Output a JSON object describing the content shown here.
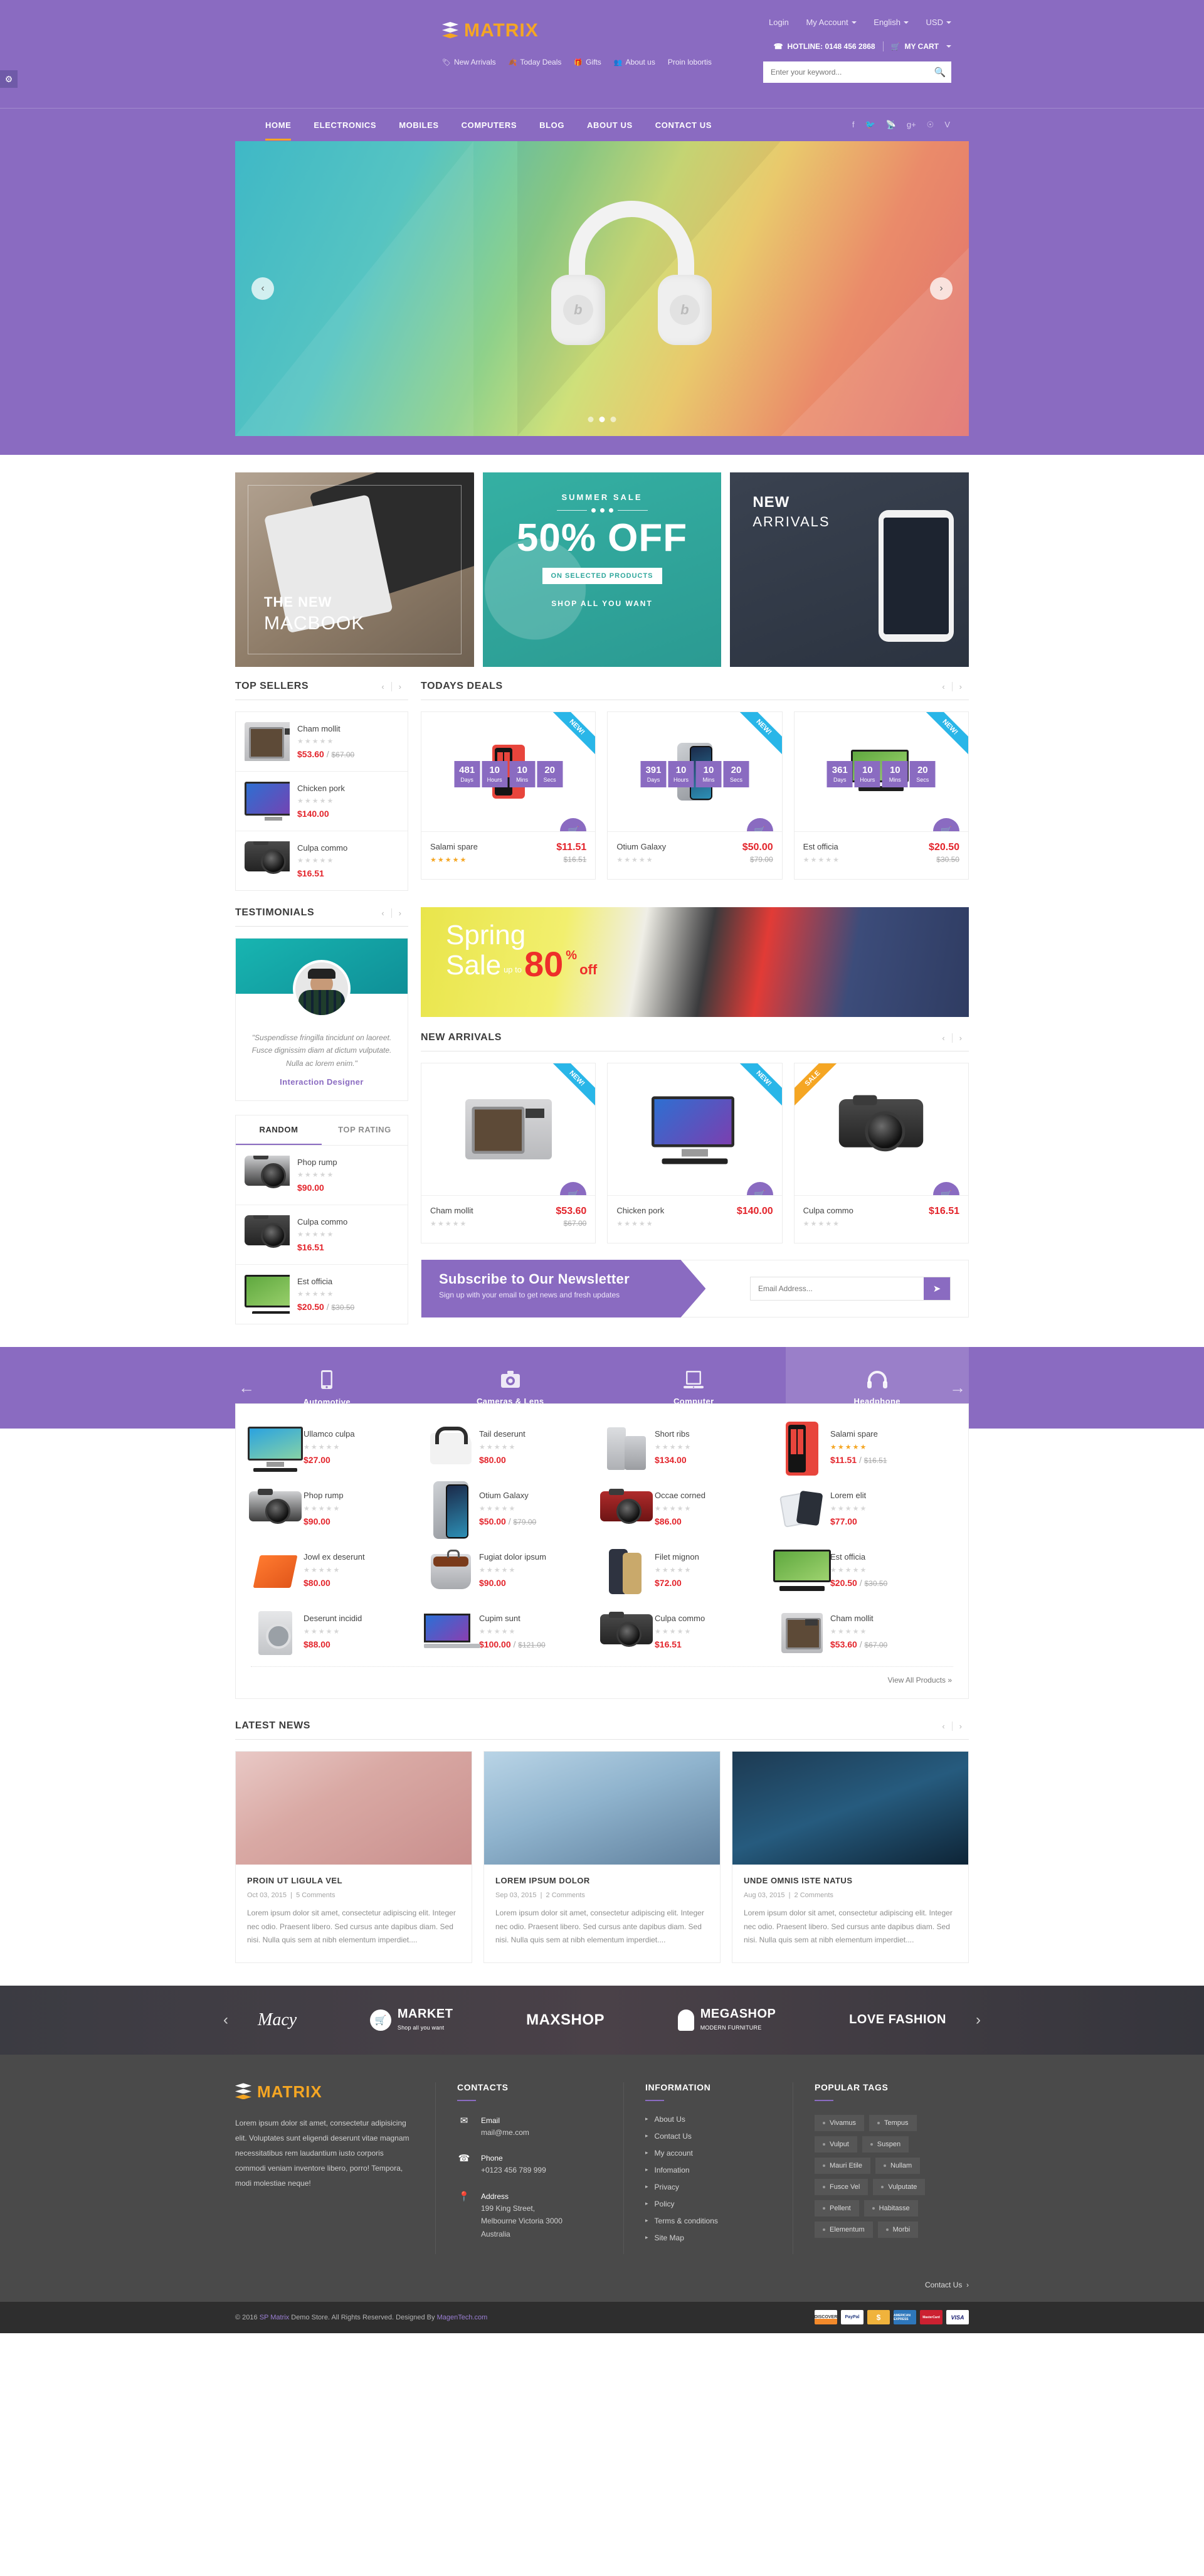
{
  "brand": {
    "name_main": "MATRI",
    "name_accent": "X"
  },
  "topbar": {
    "links": [
      {
        "label": "Login",
        "caret": false
      },
      {
        "label": "My Account",
        "caret": true
      },
      {
        "label": "English",
        "caret": true
      },
      {
        "label": "USD",
        "caret": true
      }
    ],
    "hotline": "HOTLINE: 0148 456 2868",
    "cart": "MY CART"
  },
  "search": {
    "placeholder": "Enter your keyword...",
    "value": ""
  },
  "quick_links": [
    {
      "label": "New Arrivals",
      "icon": "tag-icon"
    },
    {
      "label": "Today Deals",
      "icon": "leaf-icon"
    },
    {
      "label": "Gifts",
      "icon": "gift-icon"
    },
    {
      "label": "About us",
      "icon": "users-icon"
    },
    {
      "label": "Proin lobortis",
      "icon": ""
    }
  ],
  "nav": {
    "items": [
      "HOME",
      "ELECTRONICS",
      "MOBILES",
      "COMPUTERS",
      "BLOG",
      "ABOUT US",
      "CONTACT US"
    ],
    "active": "HOME",
    "socials": [
      "facebook-icon",
      "twitter-icon",
      "rss-icon",
      "google-plus-icon",
      "pinterest-icon",
      "vine-icon"
    ]
  },
  "slider": {
    "dots": 3,
    "active_dot": 2,
    "prev": "‹",
    "next": "›"
  },
  "promos": [
    {
      "id": "macbook",
      "line1": "THE NEW",
      "line2": "MACBOOK"
    },
    {
      "id": "summer-sale",
      "eyebrow": "SUMMER SALE",
      "headline": "50% OFF",
      "pill": "ON SELECTED PRODUCTS",
      "footer": "SHOP ALL YOU WANT"
    },
    {
      "id": "new-arrivals",
      "line1": "NEW",
      "line2": "ARRIVALS"
    }
  ],
  "top_sellers": {
    "title": "TOP SELLERS",
    "items": [
      {
        "name": "Cham mollit",
        "stars": 0,
        "price": "$53.60",
        "old": "$67.00",
        "art": "microwave"
      },
      {
        "name": "Chicken pork",
        "stars": 0,
        "price": "$140.00",
        "old": "",
        "art": "monitor"
      },
      {
        "name": "Culpa commo",
        "stars": 0,
        "price": "$16.51",
        "old": "",
        "art": "camera"
      }
    ]
  },
  "todays_deals": {
    "title": "TODAYS DEALS",
    "items": [
      {
        "name": "Salami spare",
        "price": "$11.51",
        "old": "$16.51",
        "stars": 5,
        "badge": "NEW!",
        "badge_type": "new",
        "countdown": {
          "days": "481",
          "hours": "10",
          "mins": "10",
          "secs": "20"
        },
        "art": "phone-red"
      },
      {
        "name": "Otium Galaxy",
        "price": "$50.00",
        "old": "$79.00",
        "stars": 0,
        "badge": "NEW!",
        "badge_type": "new",
        "countdown": {
          "days": "391",
          "hours": "10",
          "mins": "10",
          "secs": "20"
        },
        "art": "phone-silver"
      },
      {
        "name": "Est officia",
        "price": "$20.50",
        "old": "$30.50",
        "stars": 0,
        "badge": "NEW!",
        "badge_type": "new",
        "countdown": {
          "days": "361",
          "hours": "10",
          "mins": "10",
          "secs": "20"
        },
        "art": "aio"
      }
    ],
    "countdown_labels": {
      "days": "Days",
      "hours": "Hours",
      "mins": "Mins",
      "secs": "Secs"
    }
  },
  "testimonials": {
    "title": "TESTIMONIALS",
    "quote": "\"Suspendisse fringilla tincidunt on laoreet. Fusce dignissim diam at dictum vulputate. Nulla ac lorem enim.\"",
    "role": "Interaction Designer"
  },
  "spring_banner": {
    "line1": "Spring",
    "line2": "Sale",
    "small": "up to",
    "big": "80",
    "pct": "%",
    "off": "off"
  },
  "widget_tabs": {
    "tabs": [
      "RANDOM",
      "TOP RATING"
    ],
    "active": "RANDOM",
    "items": [
      {
        "name": "Phop rump",
        "stars": 0,
        "price": "$90.00",
        "old": "",
        "art": "camera-retro"
      },
      {
        "name": "Culpa commo",
        "stars": 0,
        "price": "$16.51",
        "old": "",
        "art": "camera"
      },
      {
        "name": "Est officia",
        "stars": 0,
        "price": "$20.50",
        "old": "$30.50",
        "art": "aio"
      }
    ]
  },
  "new_arrivals": {
    "title": "NEW ARRIVALS",
    "items": [
      {
        "name": "Cham mollit",
        "price": "$53.60",
        "old": "$67.00",
        "stars": 0,
        "badge": "NEW!",
        "badge_type": "new",
        "art": "microwave"
      },
      {
        "name": "Chicken pork",
        "price": "$140.00",
        "old": "",
        "stars": 0,
        "badge": "NEW!",
        "badge_type": "new",
        "art": "monitor"
      },
      {
        "name": "Culpa commo",
        "price": "$16.51",
        "old": "",
        "stars": 0,
        "badge": "SALE",
        "badge_type": "sale",
        "art": "camera"
      }
    ]
  },
  "newsletter": {
    "title": "Subscribe to Our Newsletter",
    "subtitle": "Sign up with your email to get news and fresh updates",
    "placeholder": "Email Address...",
    "value": "",
    "submit_icon": "paper-plane-icon"
  },
  "categories": {
    "items": [
      {
        "label": "Automotive",
        "icon": "mobile-icon",
        "active": false
      },
      {
        "label": "Cameras & Lens",
        "icon": "camera-icon",
        "active": false
      },
      {
        "label": "Computer",
        "icon": "laptop-icon",
        "active": false
      },
      {
        "label": "Headphone",
        "icon": "headphone-icon",
        "active": true
      }
    ],
    "prev": "←",
    "next": "→"
  },
  "product_grid": {
    "view_all": "View All Products »",
    "items": [
      {
        "name": "Ullamco culpa",
        "stars": 0,
        "price": "$27.00",
        "old": "",
        "art": "monitor-blue"
      },
      {
        "name": "Tail deserunt",
        "stars": 0,
        "price": "$80.00",
        "old": "",
        "art": "iron"
      },
      {
        "name": "Short ribs",
        "stars": 0,
        "price": "$134.00",
        "old": "",
        "art": "fridge"
      },
      {
        "name": "Salami spare",
        "stars": 5,
        "price": "$11.51",
        "old": "$16.51",
        "art": "phone-red"
      },
      {
        "name": "Phop rump",
        "stars": 0,
        "price": "$90.00",
        "old": "",
        "art": "camera-retro"
      },
      {
        "name": "Otium Galaxy",
        "stars": 0,
        "price": "$50.00",
        "old": "$79.00",
        "art": "phone-silver"
      },
      {
        "name": "Occae corned",
        "stars": 0,
        "price": "$86.00",
        "old": "",
        "art": "camera-red"
      },
      {
        "name": "Lorem elit",
        "stars": 0,
        "price": "$77.00",
        "old": "",
        "art": "tablets"
      },
      {
        "name": "Jowl ex deserunt",
        "stars": 0,
        "price": "$80.00",
        "old": "",
        "art": "orange-laptop"
      },
      {
        "name": "Fugiat dolor ipsum",
        "stars": 0,
        "price": "$90.00",
        "old": "",
        "art": "pot"
      },
      {
        "name": "Filet mignon",
        "stars": 0,
        "price": "$72.00",
        "old": "",
        "art": "case"
      },
      {
        "name": "Est officia",
        "stars": 0,
        "price": "$20.50",
        "old": "$30.50",
        "art": "aio"
      },
      {
        "name": "Deserunt incidid",
        "stars": 0,
        "price": "$88.00",
        "old": "",
        "art": "washer"
      },
      {
        "name": "Cupim sunt",
        "stars": 0,
        "price": "$100.00",
        "old": "$121.00",
        "art": "laptop"
      },
      {
        "name": "Culpa commo",
        "stars": 0,
        "price": "$16.51",
        "old": "",
        "art": "camera"
      },
      {
        "name": "Cham mollit",
        "stars": 0,
        "price": "$53.60",
        "old": "$67.00",
        "art": "microwave"
      }
    ]
  },
  "latest_news": {
    "title": "LATEST NEWS",
    "posts": [
      {
        "title": "PROIN UT LIGULA VEL",
        "date": "Oct 03, 2015",
        "comments": "5 Comments",
        "excerpt": "Lorem ipsum dolor sit amet, consectetur adipiscing elit. Integer nec odio. Praesent libero. Sed cursus ante dapibus diam. Sed nisi. Nulla quis sem at nibh elementum imperdiet...."
      },
      {
        "title": "LOREM IPSUM DOLOR",
        "date": "Sep 03, 2015",
        "comments": "2 Comments",
        "excerpt": "Lorem ipsum dolor sit amet, consectetur adipiscing elit. Integer nec odio. Praesent libero. Sed cursus ante dapibus diam. Sed nisi. Nulla quis sem at nibh elementum imperdiet...."
      },
      {
        "title": "UNDE OMNIS ISTE NATUS",
        "date": "Aug 03, 2015",
        "comments": "2 Comments",
        "excerpt": "Lorem ipsum dolor sit amet, consectetur adipiscing elit. Integer nec odio. Praesent libero. Sed cursus ante dapibus diam. Sed nisi. Nulla quis sem at nibh elementum imperdiet...."
      }
    ]
  },
  "brands": [
    {
      "name": "Macy",
      "style": "script"
    },
    {
      "name": "MARKET",
      "sub": "Shop all you want",
      "style": "cart"
    },
    {
      "name": "MAXSHOP",
      "style": "plain"
    },
    {
      "name": "MEGASHOP",
      "sub": "MODERN FURNITURE",
      "style": "bird"
    },
    {
      "name": "LOVE FASHION",
      "style": "plain"
    }
  ],
  "footer": {
    "about_text": "Lorem ipsum dolor sit amet, consectetur adipisicing elit. Voluptates sunt eligendi deserunt vitae magnam necessitatibus rem laudantium iusto corporis commodi veniam inventore libero, porro! Tempora, modi molestiae neque!",
    "contacts": {
      "title": "CONTACTS",
      "items": [
        {
          "icon": "envelope-icon",
          "label": "Email",
          "value": "mail@me.com"
        },
        {
          "icon": "phone-icon",
          "label": "Phone",
          "value": "+0123 456 789 999"
        },
        {
          "icon": "map-pin-icon",
          "label": "Address",
          "value": "199 King Street,\nMelbourne Victoria 3000\nAustralia"
        }
      ],
      "link": "Contact Us"
    },
    "information": {
      "title": "INFORMATION",
      "items": [
        "About Us",
        "Contact Us",
        "My account",
        "Infomation",
        "Privacy",
        "Policy",
        "Terms & conditions",
        "Site Map"
      ]
    },
    "popular_tags": {
      "title": "POPULAR TAGS",
      "items": [
        "Vivamus",
        "Tempus",
        "Vulput",
        "Suspen",
        "Mauri Etile",
        "Nullam",
        "Fusce Vel",
        "Vulputate",
        "Pellent",
        "Habitasse",
        "Elementum",
        "Morbi"
      ]
    },
    "copyright_pre": "© 2016 ",
    "copyright_brand": "SP Matrix",
    "copyright_mid": " Demo Store. All Rights Reserved. Designed By ",
    "copyright_link": "MagenTech.com",
    "payments": [
      "DISCOVER",
      "PayPal",
      "$",
      "AMERICAN EXPRESS",
      "MasterCard",
      "VISA"
    ]
  },
  "colors": {
    "brand_purple": "#8a6bc1",
    "accent_orange": "#f5a623",
    "price_red": "#e3242b",
    "badge_blue": "#29b6e8"
  }
}
